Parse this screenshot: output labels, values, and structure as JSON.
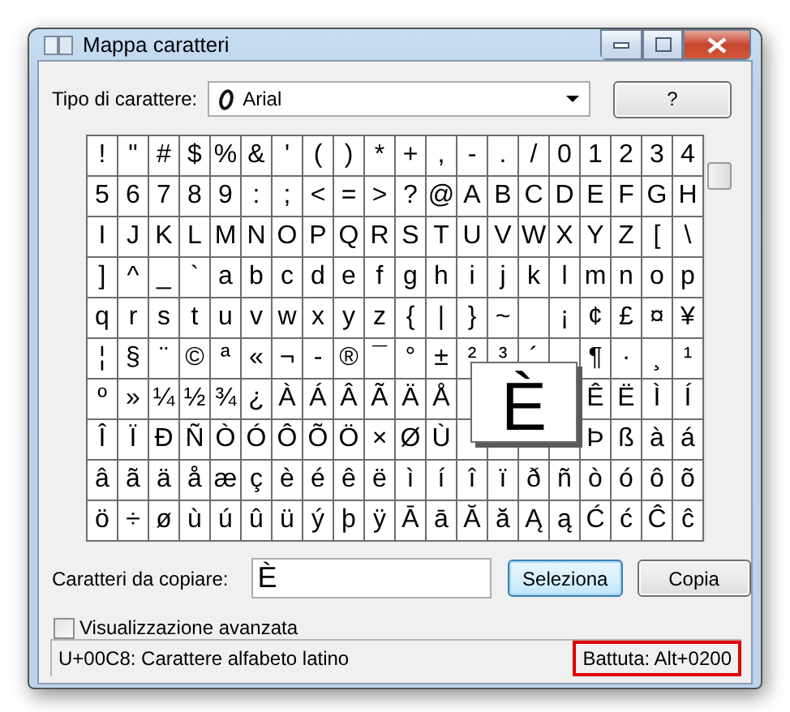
{
  "window": {
    "title": "Mappa caratteri"
  },
  "font": {
    "label": "Tipo di carattere:",
    "value": "Arial",
    "help_button": "?"
  },
  "grid": {
    "rows": [
      [
        "!",
        "\"",
        "#",
        "$",
        "%",
        "&",
        "'",
        "(",
        ")",
        "*",
        "+",
        ",",
        "-",
        ".",
        "/",
        "0",
        "1",
        "2",
        "3",
        "4"
      ],
      [
        "5",
        "6",
        "7",
        "8",
        "9",
        ":",
        ";",
        "<",
        "=",
        ">",
        "?",
        "@",
        "A",
        "B",
        "C",
        "D",
        "E",
        "F",
        "G",
        "H"
      ],
      [
        "I",
        "J",
        "K",
        "L",
        "M",
        "N",
        "O",
        "P",
        "Q",
        "R",
        "S",
        "T",
        "U",
        "V",
        "W",
        "X",
        "Y",
        "Z",
        "[",
        "\\"
      ],
      [
        "]",
        "^",
        "_",
        "`",
        "a",
        "b",
        "c",
        "d",
        "e",
        "f",
        "g",
        "h",
        "i",
        "j",
        "k",
        "l",
        "m",
        "n",
        "o",
        "p"
      ],
      [
        "q",
        "r",
        "s",
        "t",
        "u",
        "v",
        "w",
        "x",
        "y",
        "z",
        "{",
        "|",
        "}",
        "~",
        null,
        "¡",
        "¢",
        "£",
        "¤",
        "¥"
      ],
      [
        "¦",
        "§",
        "¨",
        "©",
        "ª",
        "«",
        "¬",
        "-",
        "®",
        "¯",
        "°",
        "±",
        "²",
        "³",
        "´",
        null,
        "¶",
        "·",
        "¸",
        "¹"
      ],
      [
        "º",
        "»",
        "¼",
        "½",
        "¾",
        "¿",
        "À",
        "Á",
        "Â",
        "Ã",
        "Ä",
        "Å",
        null,
        null,
        null,
        null,
        "Ê",
        "Ë",
        "Ì",
        "Í"
      ],
      [
        "Î",
        "Ï",
        "Ð",
        "Ñ",
        "Ò",
        "Ó",
        "Ô",
        "Õ",
        "Ö",
        "×",
        "Ø",
        "Ù",
        null,
        null,
        null,
        null,
        "Þ",
        "ß",
        "à",
        "á"
      ],
      [
        "â",
        "ã",
        "ä",
        "å",
        "æ",
        "ç",
        "è",
        "é",
        "ê",
        "ë",
        "ì",
        "í",
        "î",
        "ï",
        "ð",
        "ñ",
        "ò",
        "ó",
        "ô",
        "õ"
      ],
      [
        "ö",
        "÷",
        "ø",
        "ù",
        "ú",
        "û",
        "ü",
        "ý",
        "þ",
        "ÿ",
        "Ā",
        "ā",
        "Ă",
        "ă",
        "Ą",
        "ą",
        "Ć",
        "ć",
        "Ĉ",
        "ĉ"
      ]
    ],
    "magnifier": "È"
  },
  "copy": {
    "label": "Caratteri da copiare:",
    "value": "È",
    "select_button": {
      "label": "Seleziona",
      "focused": true
    },
    "copy_button": {
      "label": "Copia",
      "focused": false
    }
  },
  "advanced": {
    "label": "Visualizzazione avanzata",
    "checked": false
  },
  "status": {
    "description": "U+00C8: Carattere alfabeto latino",
    "keystroke": "Battuta: Alt+0200",
    "highlighted": true
  }
}
